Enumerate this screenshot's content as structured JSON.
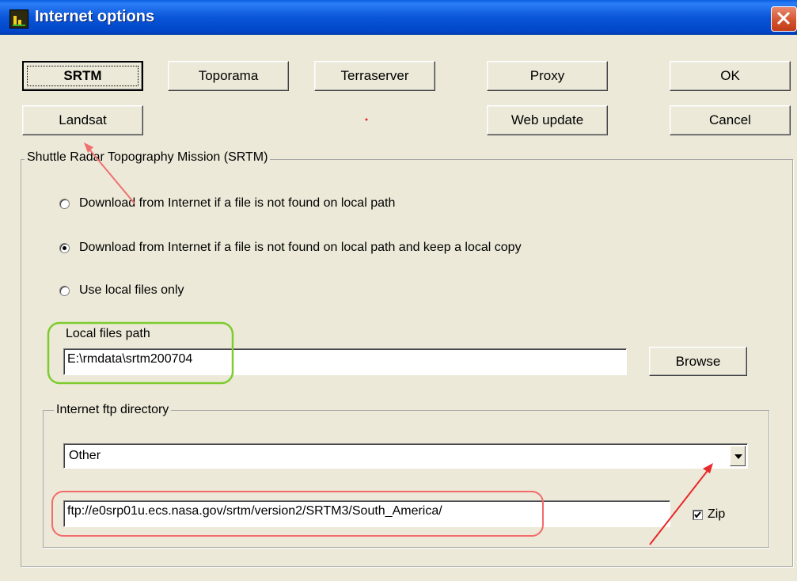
{
  "window": {
    "title": "Internet options",
    "app_icon": "chart-bars-icon",
    "close_icon": "close-icon"
  },
  "buttons": {
    "srtm": "SRTM",
    "toporama": "Toporama",
    "terraserver": "Terraserver",
    "proxy": "Proxy",
    "ok": "OK",
    "landsat": "Landsat",
    "web_update": "Web update",
    "cancel": "Cancel",
    "browse": "Browse"
  },
  "srtm_group": {
    "legend": "Shuttle Radar Topography Mission (SRTM)",
    "options": [
      {
        "label": "Download from Internet if a file is not found on local path",
        "checked": false
      },
      {
        "label": "Download from Internet if a file is not found on local path and keep a local copy",
        "checked": true
      },
      {
        "label": "Use local files only",
        "checked": false
      }
    ],
    "local_path_label": "Local files path",
    "local_path_value": "E:\\rmdata\\srtm200704"
  },
  "ftp_group": {
    "legend": "Internet ftp directory",
    "selected": "Other",
    "url": "ftp://e0srp01u.ecs.nasa.gov/srtm/version2/SRTM3/South_America/",
    "zip_label": "Zip",
    "zip_checked": true
  },
  "annotation_colors": {
    "green": "#7DCB2E",
    "red": "#F36A6A",
    "arrow_red": "#E8282A",
    "arrow_pink": "#F07070"
  }
}
